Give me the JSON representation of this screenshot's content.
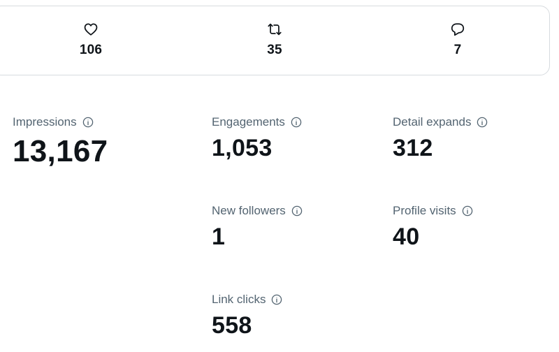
{
  "engagement_bar": {
    "likes": {
      "icon": "heart-icon",
      "value": "106"
    },
    "reposts": {
      "icon": "repost-icon",
      "value": "35"
    },
    "replies": {
      "icon": "reply-icon",
      "value": "7"
    }
  },
  "metrics": {
    "impressions": {
      "label": "Impressions",
      "value": "13,167"
    },
    "engagements": {
      "label": "Engagements",
      "value": "1,053"
    },
    "detail_expands": {
      "label": "Detail expands",
      "value": "312"
    },
    "new_followers": {
      "label": "New followers",
      "value": "1"
    },
    "profile_visits": {
      "label": "Profile visits",
      "value": "40"
    },
    "link_clicks": {
      "label": "Link clicks",
      "value": "558"
    }
  },
  "colors": {
    "text_primary": "#0f1419",
    "text_secondary": "#536471",
    "border": "#d7dbdf"
  }
}
